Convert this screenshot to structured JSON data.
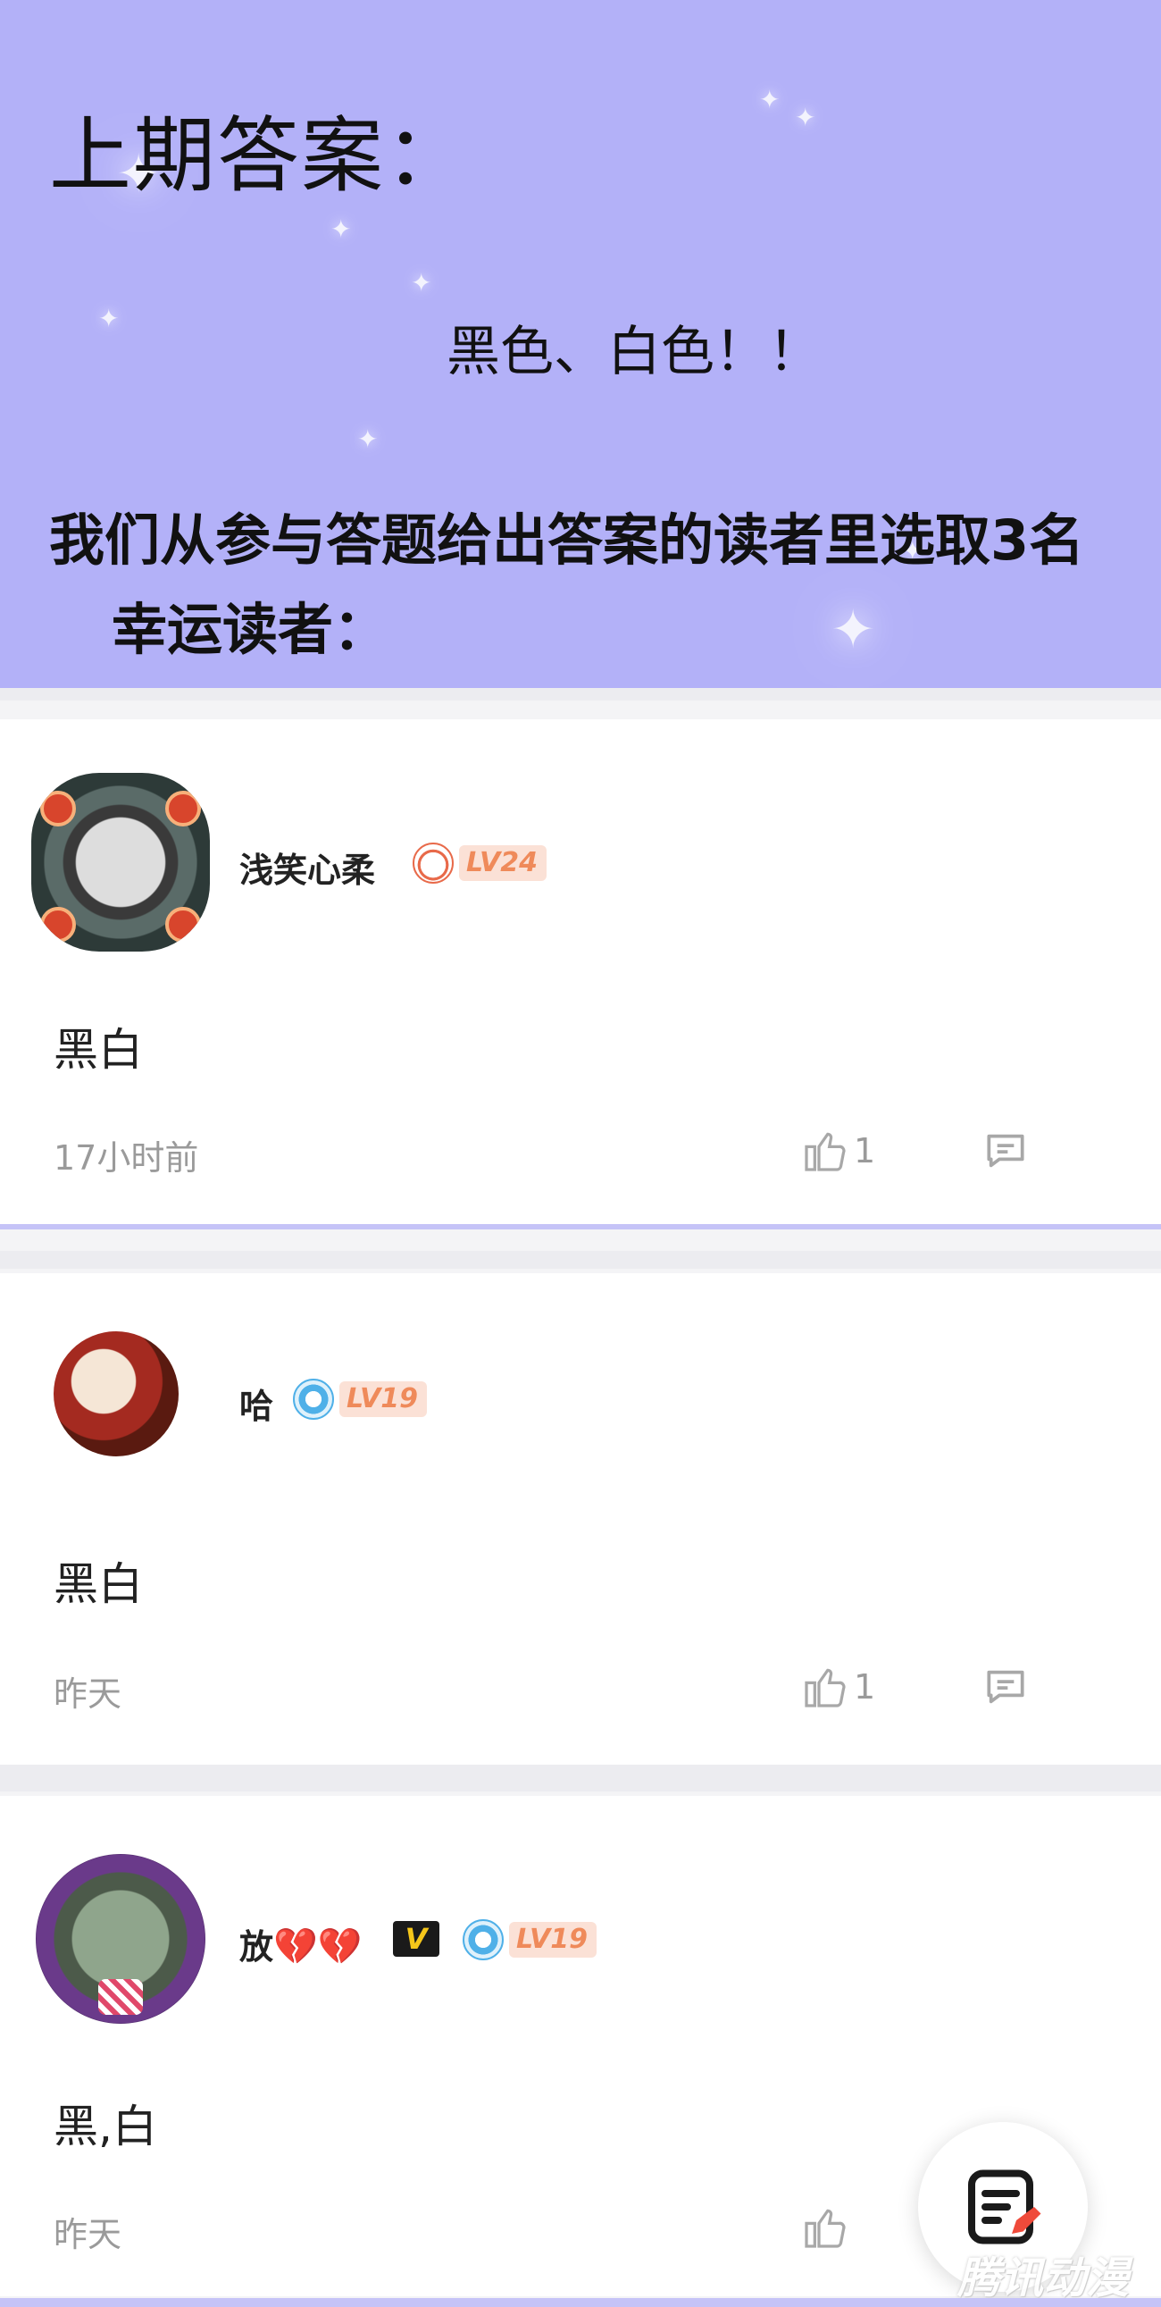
{
  "hero": {
    "title": "上期答案：",
    "answer": "黑色、白色！！",
    "desc_line1": "我们从参与答题给出答案的读者里选取3名",
    "desc_line2": "幸运读者：",
    "bg_color": "#b3b1f8"
  },
  "comments": [
    {
      "username": "浅笑心柔",
      "level": "LV24",
      "text": "黑白",
      "time": "17小时前",
      "likes": "1"
    },
    {
      "username": "哈",
      "level": "LV19",
      "text": "黑白",
      "time": "昨天",
      "likes": "1"
    },
    {
      "username": "放",
      "username_emoji": "💔💔",
      "vip": "V",
      "level": "LV19",
      "text": "黑,白",
      "time": "昨天",
      "likes": ""
    }
  ],
  "watermark": "腾讯动漫",
  "icons": {
    "like": "thumbs-up-icon",
    "reply": "comment-bubble-icon",
    "fab": "write-comment-icon"
  }
}
